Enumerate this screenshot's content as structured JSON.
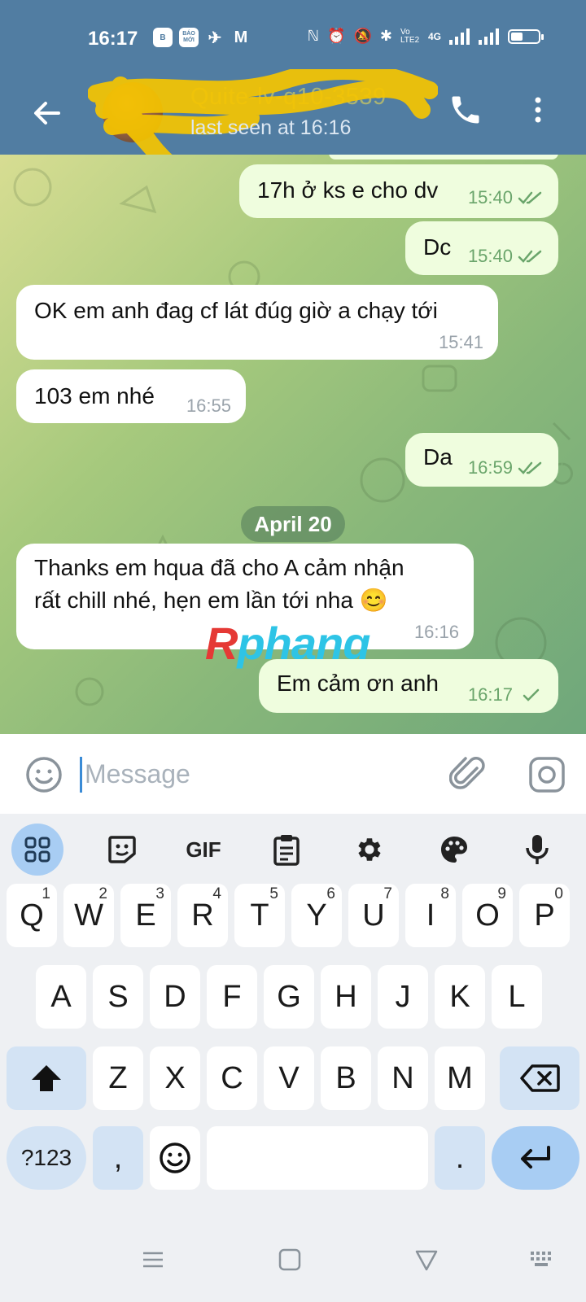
{
  "status_bar": {
    "time": "16:17",
    "app_icons": [
      "B",
      "BÁO MỚI",
      "✈",
      "M"
    ],
    "right_glyphs": [
      "ℕ",
      "⏰",
      "🔕",
      "✱",
      "Vo LTE2",
      "4G"
    ]
  },
  "header": {
    "contact_name": "Quite-lv-q10-3539",
    "status": "last seen at 16:16"
  },
  "messages": [
    {
      "dir": "out",
      "text": "17h ở ks e cho dv",
      "time": "15:40",
      "read": true
    },
    {
      "dir": "out",
      "text": "Dc",
      "time": "15:40",
      "read": true
    },
    {
      "dir": "in",
      "text": "OK em anh đag cf lát đúg giờ a chạy tới",
      "time": "15:41"
    },
    {
      "dir": "in",
      "text": "103 em nhé",
      "time": "16:55"
    },
    {
      "dir": "out",
      "text": "Da",
      "time": "16:59",
      "read": true
    },
    {
      "dir": "in",
      "text_line1": "Thanks em hqua đã cho A cảm nhận",
      "text_line2": "rất chill nhé, hẹn em lần tới nha 😊",
      "time": "16:16"
    },
    {
      "dir": "out",
      "text": "Em cảm ơn anh",
      "time": "16:17",
      "read": false
    }
  ],
  "date_separator": "April 20",
  "watermark": {
    "first": "R",
    "rest": "phang"
  },
  "composer": {
    "placeholder": "Message"
  },
  "keyboard": {
    "toolbar": [
      "apps",
      "sticker",
      "GIF",
      "clipboard",
      "settings",
      "theme",
      "mic"
    ],
    "gif_label": "GIF",
    "row1": [
      {
        "key": "Q",
        "hint": "1"
      },
      {
        "key": "W",
        "hint": "2"
      },
      {
        "key": "E",
        "hint": "3"
      },
      {
        "key": "R",
        "hint": "4"
      },
      {
        "key": "T",
        "hint": "5"
      },
      {
        "key": "Y",
        "hint": "6"
      },
      {
        "key": "U",
        "hint": "7"
      },
      {
        "key": "I",
        "hint": "8"
      },
      {
        "key": "O",
        "hint": "9"
      },
      {
        "key": "P",
        "hint": "0"
      }
    ],
    "row2": [
      "A",
      "S",
      "D",
      "F",
      "G",
      "H",
      "J",
      "K",
      "L"
    ],
    "row3": [
      "Z",
      "X",
      "C",
      "V",
      "B",
      "N",
      "M"
    ],
    "sym_label": "?123",
    "comma": ",",
    "period": "."
  },
  "colors": {
    "header": "#517da2",
    "outgoing_bubble": "#effdde",
    "incoming_bubble": "#ffffff",
    "check_green": "#6aa56b",
    "keyboard_accent": "#a8cdf3"
  }
}
